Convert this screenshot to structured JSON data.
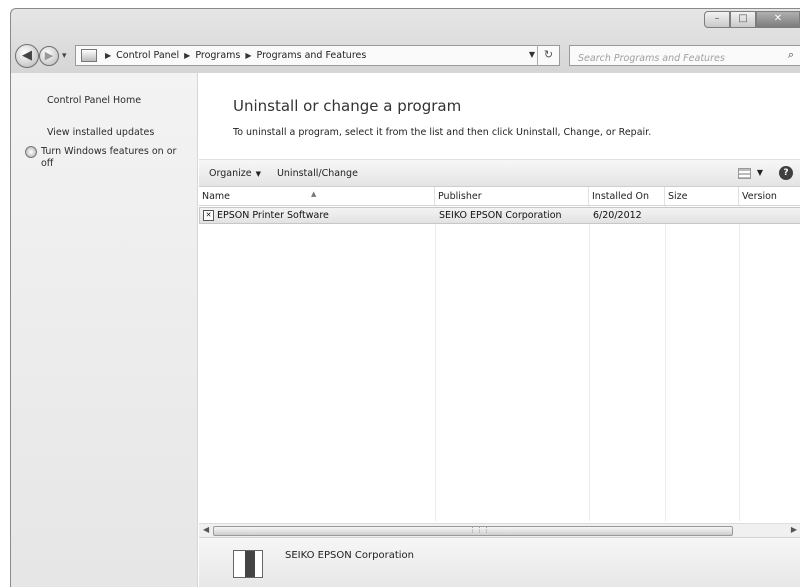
{
  "window": {
    "controls": {
      "minimize": "–",
      "maximize": "□",
      "close": "✕"
    }
  },
  "nav": {
    "back": "◀",
    "forward": "▶",
    "recent": "▾",
    "breadcrumbs": [
      "Control Panel",
      "Programs",
      "Programs and Features"
    ],
    "refresh": "↻",
    "search_placeholder": "Search Programs and Features"
  },
  "sidebar": {
    "items": [
      {
        "label": "Control Panel Home"
      },
      {
        "label": "View installed updates"
      },
      {
        "label": "Turn Windows features on or off"
      }
    ]
  },
  "main": {
    "title": "Uninstall or change a program",
    "description": "To uninstall a program, select it from the list and then click Uninstall, Change, or Repair."
  },
  "toolbar": {
    "organize": "Organize",
    "uninstall_change": "Uninstall/Change",
    "help": "?"
  },
  "list": {
    "columns": [
      "Name",
      "Publisher",
      "Installed On",
      "Size",
      "Version"
    ],
    "rows": [
      {
        "name": "EPSON Printer Software",
        "publisher": "SEIKO EPSON Corporation",
        "installed_on": "6/20/2012",
        "size": "",
        "version": ""
      }
    ]
  },
  "details": {
    "publisher": "SEIKO EPSON Corporation"
  }
}
